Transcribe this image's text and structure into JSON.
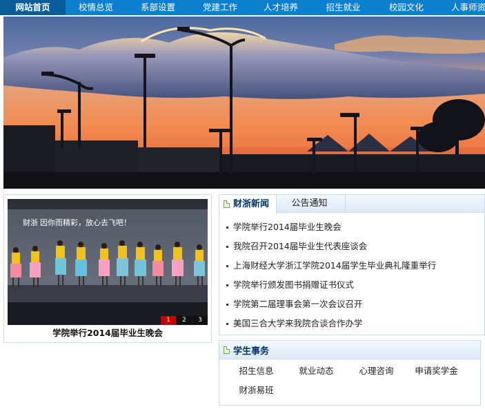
{
  "nav": {
    "items": [
      "网站首页",
      "校情总览",
      "系部设置",
      "党建工作",
      "人才培养",
      "招生就业",
      "校园文化",
      "人事师资"
    ],
    "active_index": 0,
    "bg_color": "#0d7fcf",
    "active_color": "#0a5d98"
  },
  "slideshow": {
    "caption": "学院举行2014届毕业生晚会",
    "stage_banner_text": "财浙  因你而精彩，放心去飞吧！",
    "pages": [
      "1",
      "2",
      "3"
    ],
    "current_page": 1
  },
  "news": {
    "tabs": [
      "财浙新闻",
      "公告通知"
    ],
    "active_tab": 0,
    "items": [
      "学院举行2014届毕业生晚会",
      "我院召开2014届毕业生代表座谈会",
      "上海财经大学浙江学院2014届学生毕业典礼隆重举行",
      "学院举行颁发图书捐赠证书仪式",
      "学院第二届理事会第一次会议召开",
      "美国三合大学来我院合谈合作办学"
    ]
  },
  "student_affairs": {
    "title": "学生事务",
    "links": [
      "招生信息",
      "就业动态",
      "心理咨询",
      "申请奖学金",
      "财浙易班"
    ]
  }
}
